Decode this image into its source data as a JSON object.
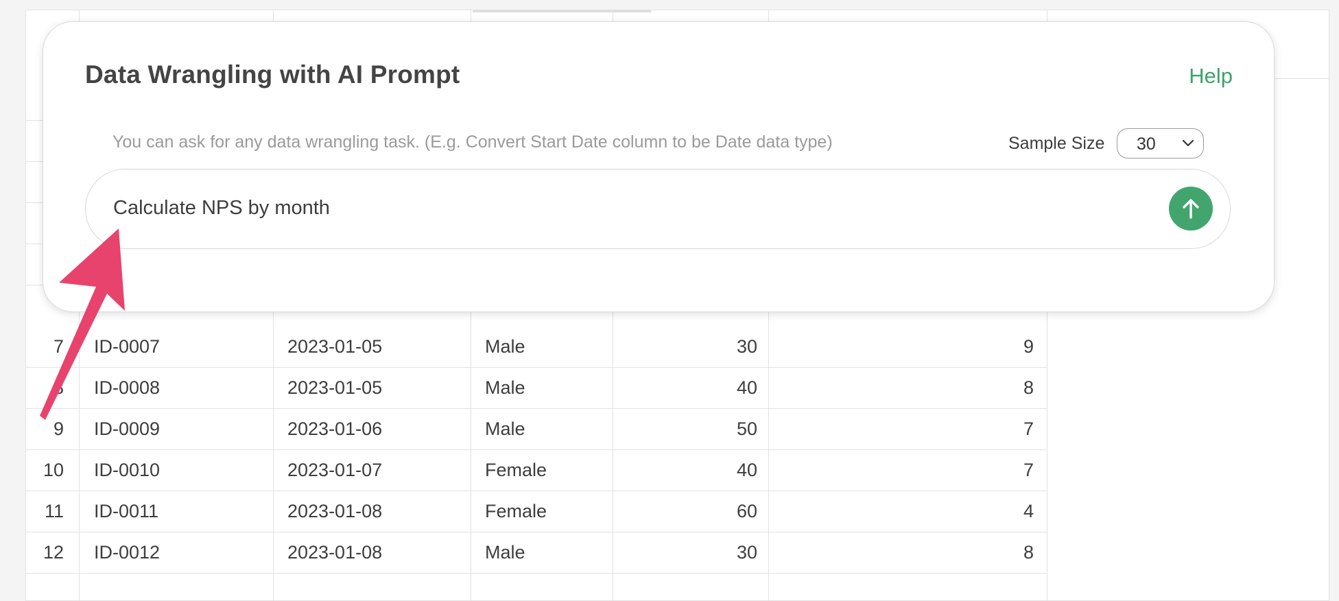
{
  "dialog": {
    "title": "Data Wrangling with AI Prompt",
    "help_label": "Help",
    "hint": "You can ask for any data wrangling task. (E.g. Convert Start Date column to be Date data type)",
    "sample_size_label": "Sample Size",
    "sample_size_value": "30",
    "prompt_value": "Calculate NPS by month",
    "send_icon": "arrow-up-icon",
    "accent_color": "#41a56d"
  },
  "table": {
    "rows": [
      {
        "index": "7",
        "id": "ID-0007",
        "date": "2023-01-05",
        "gender": "Male",
        "age": "30",
        "score": "9"
      },
      {
        "index": "8",
        "id": "ID-0008",
        "date": "2023-01-05",
        "gender": "Male",
        "age": "40",
        "score": "8"
      },
      {
        "index": "9",
        "id": "ID-0009",
        "date": "2023-01-06",
        "gender": "Male",
        "age": "50",
        "score": "7"
      },
      {
        "index": "10",
        "id": "ID-0010",
        "date": "2023-01-07",
        "gender": "Female",
        "age": "40",
        "score": "7"
      },
      {
        "index": "11",
        "id": "ID-0011",
        "date": "2023-01-08",
        "gender": "Female",
        "age": "60",
        "score": "4"
      },
      {
        "index": "12",
        "id": "ID-0012",
        "date": "2023-01-08",
        "gender": "Male",
        "age": "30",
        "score": "8"
      }
    ]
  },
  "annotation": {
    "arrow_color": "#e8436c"
  }
}
